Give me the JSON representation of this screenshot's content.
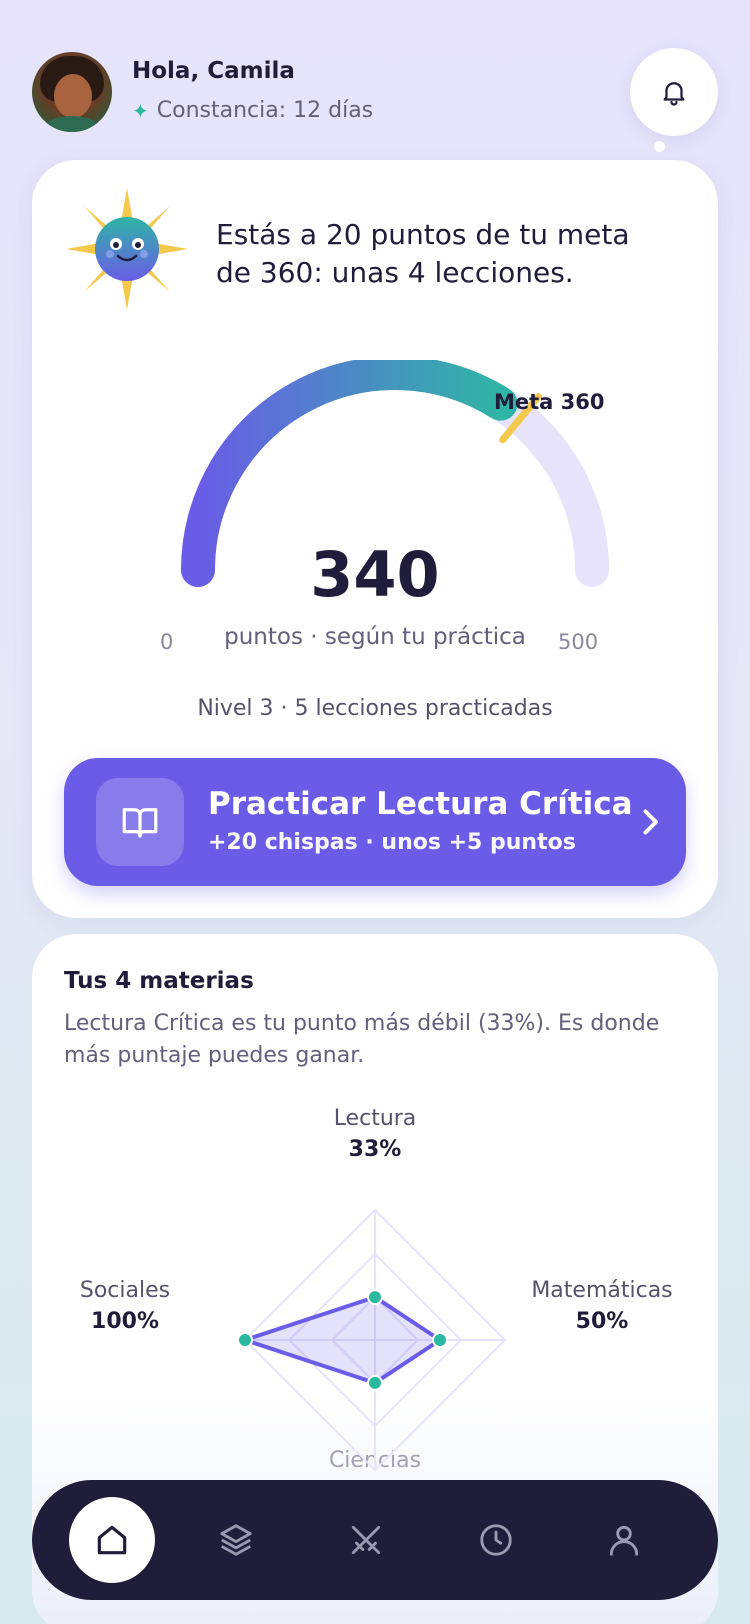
{
  "header": {
    "greeting": "Hola, Camila",
    "streak": "Constancia: 12 días",
    "streak_icon": "sparkle-icon",
    "bell_icon": "bell-icon"
  },
  "goal_card": {
    "message": "Estás a 20 puntos de tu meta de 360: unas 4 lecciones.",
    "gauge": {
      "score": "340",
      "score_value": 340,
      "min": "0",
      "max": "500",
      "goal_label": "Meta 360",
      "goal_value": 360,
      "caption": "puntos · según tu práctica"
    },
    "level_text": "Nivel 3 · 5 lecciones practicadas",
    "practice_button": {
      "title": "Practicar Lectura Crítica",
      "subtitle": "+20 chispas · unos +5 puntos",
      "icon": "book-icon"
    }
  },
  "subjects_card": {
    "title": "Tus 4 materias",
    "description": "Lectura Crítica es tu punto más débil (33%). Es donde más puntaje puedes ganar.",
    "radar": [
      {
        "name": "Lectura",
        "pct": "33%",
        "value": 33
      },
      {
        "name": "Matemáticas",
        "pct": "50%",
        "value": 50
      },
      {
        "name": "Ciencias",
        "pct": "",
        "value": 33
      },
      {
        "name": "Sociales",
        "pct": "100%",
        "value": 100
      }
    ]
  },
  "nav": {
    "items": [
      {
        "icon": "home-icon",
        "active": true
      },
      {
        "icon": "layers-icon",
        "active": false
      },
      {
        "icon": "swords-icon",
        "active": false
      },
      {
        "icon": "clock-icon",
        "active": false
      },
      {
        "icon": "user-icon",
        "active": false
      }
    ]
  },
  "colors": {
    "accent": "#6b5ce7",
    "teal": "#2bb8a0",
    "goal_marker": "#f2c94c",
    "dark": "#1f1d3a"
  }
}
